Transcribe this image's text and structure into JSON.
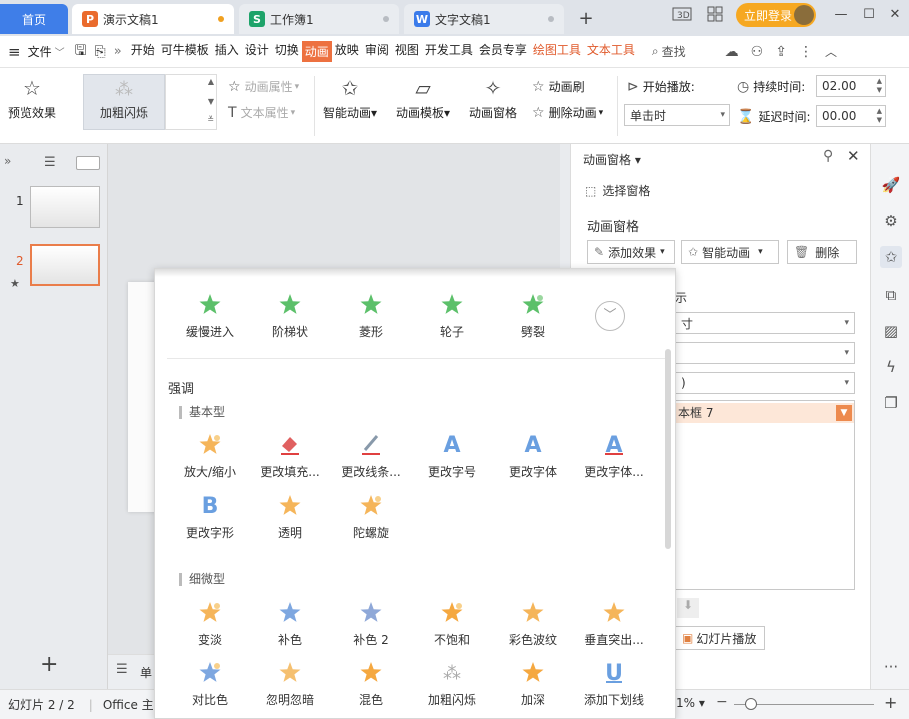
{
  "titlebar": {
    "home": "首页",
    "tabs": [
      {
        "icon": "P",
        "label": "演示文稿1",
        "color": "#ea6b2d"
      },
      {
        "icon": "S",
        "label": "工作簿1",
        "color": "#1ea36a"
      },
      {
        "icon": "W",
        "label": "文字文稿1",
        "color": "#3b7bea"
      }
    ],
    "new_tab": "+",
    "login": "立即登录",
    "accent": "#3f7ee8"
  },
  "menubar": {
    "file": "文件",
    "items": [
      "开始",
      "可牛模板",
      "插入",
      "设计",
      "切换",
      "动画",
      "放映",
      "审阅",
      "视图",
      "开发工具",
      "会员专享",
      "绘图工具",
      "文本工具"
    ],
    "active": "动画",
    "search": "查找",
    "accent": "#ed7140"
  },
  "ribbon": {
    "preview": "预览效果",
    "current_effect": "加粗闪烁",
    "anim_props": "动画属性",
    "text_props": "文本属性",
    "smart_anim": "智能动画",
    "anim_template": "动画模板",
    "anim_pane": "动画窗格",
    "anim_brush": "动画刷",
    "delete_anim": "删除动画",
    "start_play": "开始播放:",
    "start_value": "单击时",
    "duration_label": "持续时间:",
    "duration_value": "02.00",
    "delay_label": "延迟时间:",
    "delay_value": "00.00"
  },
  "slides": {
    "items": [
      {
        "num": "1"
      },
      {
        "num": "2"
      }
    ],
    "add": "+"
  },
  "pane": {
    "title": "动画窗格",
    "select_pane": "选择窗格",
    "subtitle": "动画窗格",
    "add_effect": "添加效果",
    "smart_anim": "智能动画",
    "delete": "删除",
    "partial_label": "示",
    "field1": "寸",
    "field3": ")",
    "list_item": "本框 7",
    "play_button": "幻灯片播放"
  },
  "dropdown": {
    "top_row": [
      "缓慢进入",
      "阶梯状",
      "菱形",
      "轮子",
      "劈裂"
    ],
    "section_emphasis": "强调",
    "basic_label": "基本型",
    "basic": [
      "放大/缩小",
      "更改填充...",
      "更改线条...",
      "更改字号",
      "更改字体",
      "更改字体...",
      "更改字形",
      "透明",
      "陀螺旋"
    ],
    "subtle_label": "细微型",
    "subtle": [
      "变淡",
      "补色",
      "补色 2",
      "不饱和",
      "彩色波纹",
      "垂直突出...",
      "对比色",
      "忽明忽暗",
      "混色",
      "加粗闪烁",
      "加深",
      "添加下划线"
    ]
  },
  "statusbar": {
    "slide_info": "幻灯片 2 / 2",
    "theme": "Office 主题",
    "notes_partial": "单",
    "zoom_partial": "1%",
    "plus": "+"
  }
}
